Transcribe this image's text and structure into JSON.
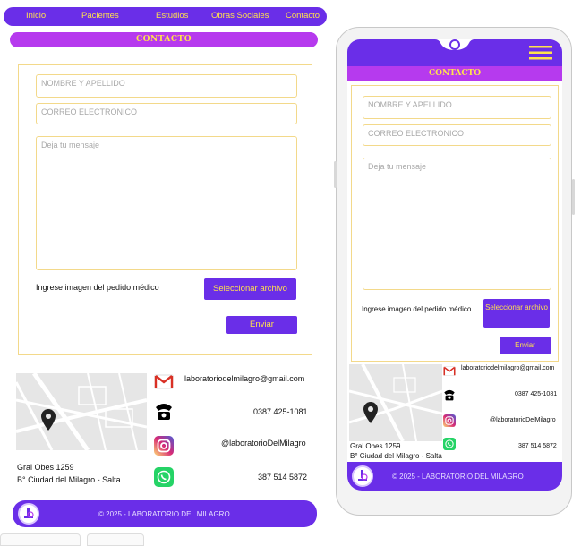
{
  "nav": {
    "items": [
      "Inicio",
      "Pacientes",
      "Estudios",
      "Obras Sociales",
      "Contacto"
    ]
  },
  "section_title": "CONTACTO",
  "form": {
    "name_placeholder": "NOMBRE Y APELLIDO",
    "email_placeholder": "CORREO ELECTRONICO",
    "message_placeholder": "Deja tu mensaje",
    "upload_label": "Ingrese imagen del pedido médico",
    "upload_button": "Seleccionar archivo",
    "submit_button": "Enviar"
  },
  "contact": {
    "email": "laboratoriodelmilagro@gmail.com",
    "phone": "0387 425-1081",
    "instagram": "@laboratorioDelMilagro",
    "mobile_instagram": "@laboratorioDelMilagro",
    "whatsapp": "387 514 5872",
    "address_line1": "Gral Obes 1259",
    "address_line2": "B° Ciudad del Milagro - Salta"
  },
  "footer": {
    "copyright": "© 2025 - LABORATORIO DEL MILAGRO"
  },
  "mobile": {
    "copyright": "© 2025 - LABORATORIO DEL MILAGRO",
    "upload_button": "Seleccionar archivo"
  },
  "colors": {
    "primary": "#6a2ee8",
    "accent": "#ffe14d",
    "title_bar": "#b63aee",
    "border": "#f3d98a"
  },
  "icons": [
    "gmail-icon",
    "phone-icon",
    "instagram-icon",
    "whatsapp-icon",
    "map-pin-icon",
    "hamburger-menu-icon"
  ]
}
